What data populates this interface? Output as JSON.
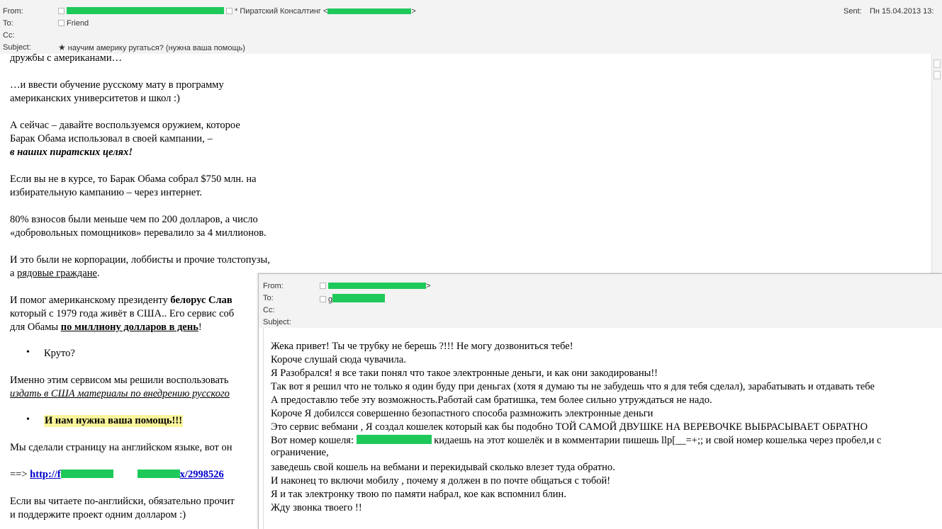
{
  "email1": {
    "from_label": "From:",
    "from_display": "* Пиратский Консалтинг <",
    "to_label": "To:",
    "to_value": "Friend",
    "cc_label": "Cc:",
    "subject_label": "Subject:",
    "subject_value": "научим америку ругаться? (нужна ваша помощь)",
    "sent_label": "Sent:",
    "sent_value": "Пн 15.04.2013 13:",
    "body": {
      "l1": "дружбы с американами…",
      "l2": "…и ввести обучение русскому мату в программу",
      "l3": "американских университетов и школ :)",
      "l4": "А сейчас – давайте воспользуемся оружием, которое",
      "l5": "Барак Обама использовал в своей кампании, –",
      "l6": "в наших пиратских целях!",
      "l7": "Если вы не в курсе, то Барак Обама собрал $750 млн. на",
      "l8": "избирательную кампанию – через интернет.",
      "l9": "80% взносов были меньше чем по 200 долларов, а число",
      "l10": "«добровольных помощников» перевалило за 4 миллионов.",
      "l11": "И это были не корпорации, лоббисты и прочие толстопузы,",
      "l12a": "а ",
      "l12b": "рядовые граждане",
      "l12c": ".",
      "l13a": "И помог американскому президенту ",
      "l13b": "белорус Слав",
      "l14": "который с 1979 года живёт в США.. Его сервис соб",
      "l15a": "для Обамы ",
      "l15b": "по миллиону долларов в день",
      "l15c": "!",
      "bullet1": "Круто?",
      "l16": "Именно этим сервисом мы решили воспользовать",
      "l17": "издать в США материалы по внедрению русского",
      "bullet2": "И нам нужна ваша помощь!!!",
      "l18": "Мы сделали страницу на английском языке, вот он",
      "l19a": "==> ",
      "l19b": "http://f",
      "l19c": "x/2998526",
      "l20": "Если вы читаете по-английски, обязательно прочит",
      "l21": "и поддержите проект одним долларом :)"
    }
  },
  "email2": {
    "from_label": "From:",
    "from_suffix": ">",
    "to_label": "To:",
    "to_prefix": "g",
    "cc_label": "Cc:",
    "subject_label": "Subject:",
    "body": [
      "Жека привет! Ты че трубку не берешь ?!!! Не могу дозвониться тебе!",
      "Короче слушай сюда чувачила.",
      "Я Разобрался! я все таки понял что такое электронные деньги, и как они закодированы!!",
      "Так вот я решил что не только я один буду при деньгах (хотя я думаю ты не забудешь что я для тебя сделал), зарабатывать и отдавать тебе",
      "А предоставлю тебе эту возможность.Работай сам братишка, тем более сильно утруждаться не надо.",
      "Короче Я добилсся совершенно безопастного способа размножить электронные деньги",
      "Это сервис вебмани , Я создал кошелек который как бы подобно ТОЙ САМОЙ ДВУШКЕ НА ВЕРЕВОЧКЕ ВЫБРАСЫВАЕТ ОБРАТНО"
    ],
    "wallet_prefix": "Вот номер кошеля: ",
    "wallet_suffix": " кидаешь на этот кошелёк и в комментарии пишешь llp[__=+;; и свой номер кошелька через пробел,и с",
    "body2": [
      "ограничение,",
      "заведешь свой кошель на вебмани и перекидывай сколько влезет туда обратно.",
      "И наконец то включи мобилу , почему я должен в по почте общаться с тобой!",
      "Я и так электронку твою по памяти набрал, кое как вспомнил блин.",
      "Жду звонка твоего !!"
    ]
  }
}
